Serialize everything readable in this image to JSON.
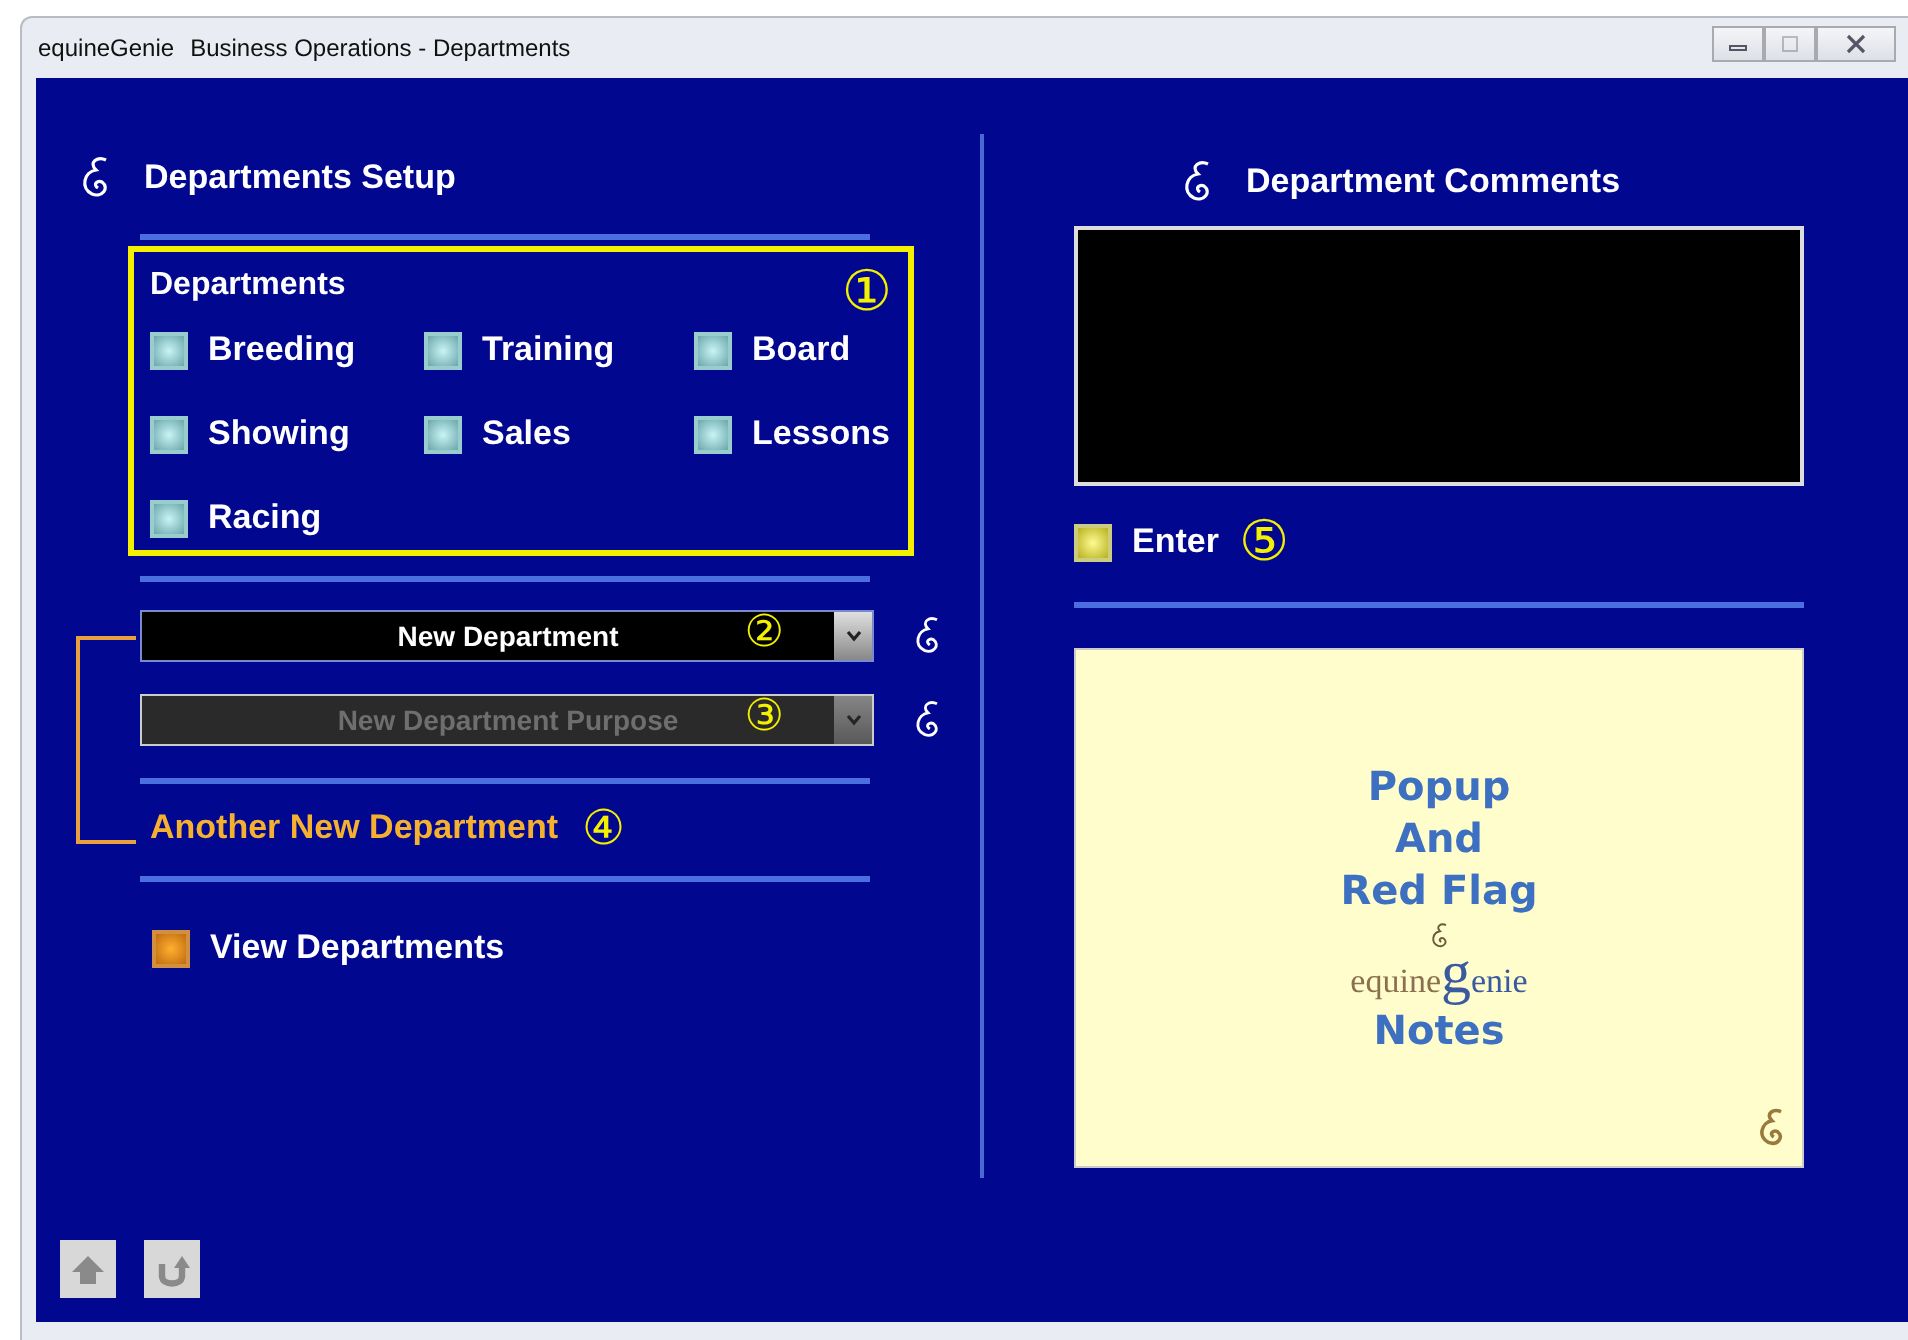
{
  "window": {
    "app": "equineGenie",
    "title": "Business Operations - Departments",
    "controls": [
      {
        "kind": "minimize",
        "disabled": false
      },
      {
        "kind": "maximize",
        "disabled": true
      },
      {
        "kind": "close",
        "disabled": false
      }
    ]
  },
  "setup": {
    "title": "Departments Setup",
    "departments": {
      "heading": "Departments",
      "marker": "①",
      "items": [
        {
          "label": "Breeding",
          "checked": false
        },
        {
          "label": "Training",
          "checked": false
        },
        {
          "label": "Board",
          "checked": false
        },
        {
          "label": "Showing",
          "checked": false
        },
        {
          "label": "Sales",
          "checked": false
        },
        {
          "label": "Lessons",
          "checked": false
        },
        {
          "label": "Racing",
          "checked": false
        }
      ]
    },
    "selectors": [
      {
        "value": "New Department",
        "marker": "②",
        "disabled": false
      },
      {
        "value": "New Department Purpose",
        "marker": "③",
        "disabled": true
      }
    ],
    "another": {
      "label": "Another New Department",
      "marker": "④"
    },
    "view": {
      "label": "View Departments"
    }
  },
  "comments": {
    "title": "Department Comments",
    "enter": {
      "label": "Enter",
      "marker": "⑤"
    }
  },
  "notes": {
    "lines": [
      "Popup",
      "And",
      "Red Flag"
    ],
    "logo": {
      "before": "equine",
      "letter": "g",
      "after": "enie"
    },
    "bottom": "Notes"
  },
  "nav": [
    {
      "kind": "home"
    },
    {
      "kind": "back"
    }
  ]
}
